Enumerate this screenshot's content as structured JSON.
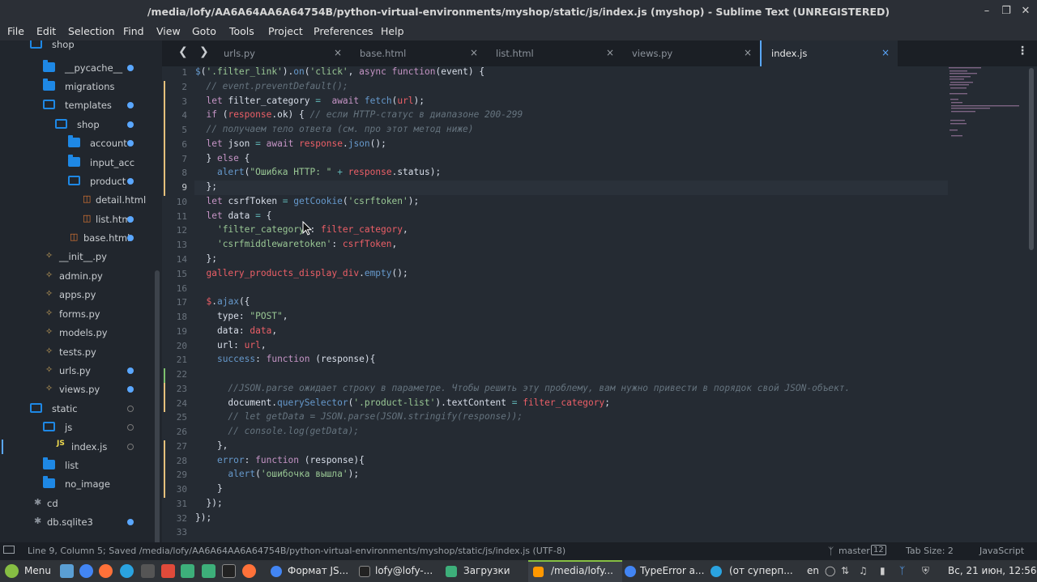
{
  "window": {
    "title": "/media/lofy/AA6A64AA6A64754B/python-virtual-environments/myshop/static/js/index.js (myshop) - Sublime Text (UNREGISTERED)"
  },
  "menu": [
    "File",
    "Edit",
    "Selection",
    "Find",
    "View",
    "Goto",
    "Tools",
    "Project",
    "Preferences",
    "Help"
  ],
  "sidebar": {
    "items": [
      {
        "label": "shop"
      },
      {
        "label": "__pycache__"
      },
      {
        "label": "migrations"
      },
      {
        "label": "templates"
      },
      {
        "label": "shop"
      },
      {
        "label": "account"
      },
      {
        "label": "input_acc"
      },
      {
        "label": "product"
      },
      {
        "label": "detail.html"
      },
      {
        "label": "list.htm"
      },
      {
        "label": "base.html"
      },
      {
        "label": "__init__.py"
      },
      {
        "label": "admin.py"
      },
      {
        "label": "apps.py"
      },
      {
        "label": "forms.py"
      },
      {
        "label": "models.py"
      },
      {
        "label": "tests.py"
      },
      {
        "label": "urls.py"
      },
      {
        "label": "views.py"
      },
      {
        "label": "static"
      },
      {
        "label": "js"
      },
      {
        "label": "index.js"
      },
      {
        "label": "list"
      },
      {
        "label": "no_image"
      },
      {
        "label": "cd"
      },
      {
        "label": "db.sqlite3"
      }
    ]
  },
  "tabs": [
    {
      "label": "urls.py",
      "close": "×"
    },
    {
      "label": "base.html",
      "close": "×"
    },
    {
      "label": "list.html",
      "close": "×"
    },
    {
      "label": "views.py",
      "close": "×"
    },
    {
      "label": "index.js",
      "close": "×"
    }
  ],
  "line_numbers": [
    "1",
    "2",
    "3",
    "4",
    "5",
    "6",
    "7",
    "8",
    "9",
    "10",
    "11",
    "12",
    "13",
    "14",
    "15",
    "16",
    "17",
    "18",
    "19",
    "20",
    "21",
    "22",
    "23",
    "24",
    "25",
    "26",
    "27",
    "28",
    "29",
    "30",
    "31",
    "32",
    "33"
  ],
  "status": {
    "message": "Line 9, Column 5; Saved /media/lofy/AA6A64AA6A64754B/python-virtual-environments/myshop/static/js/index.js (UTF-8)",
    "branch": "master",
    "branch_count": "12",
    "tab_size": "Tab Size: 2",
    "syntax": "JavaScript"
  },
  "taskbar": {
    "menu": "Menu",
    "windows": [
      "Формат JS...",
      "lofy@lofy-...",
      "Загрузки",
      "/media/lofy...",
      "TypeError a...",
      "(от суперп..."
    ],
    "lang": "en",
    "clock": "Вс, 21 июн, 12:56"
  },
  "colors": {
    "accent": "#5aa7ff",
    "modified": "#e5c07b",
    "added": "#7ec16e"
  }
}
